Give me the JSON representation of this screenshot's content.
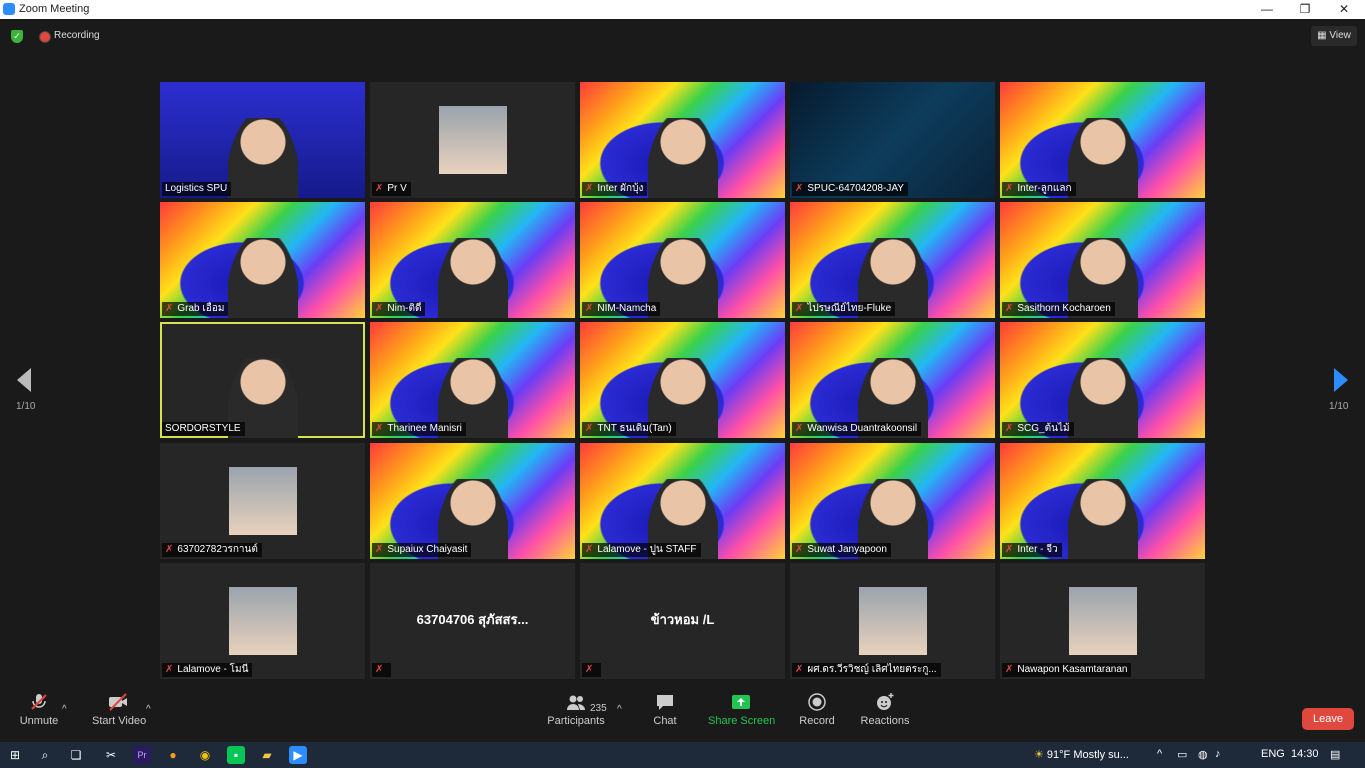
{
  "window": {
    "title": "Zoom Meeting",
    "minimize": "—",
    "maximize": "❐",
    "close": "✕"
  },
  "status": {
    "recording": "Recording",
    "view": "View"
  },
  "pager": {
    "left": "1/10",
    "right": "1/10"
  },
  "tiles": [
    {
      "name": "Logistics SPU",
      "muted": false,
      "bg": "blue"
    },
    {
      "name": "Pr V",
      "muted": true,
      "bg": "dark"
    },
    {
      "name": "Inter ผักบุ้ง",
      "muted": true,
      "bg": "camp"
    },
    {
      "name": "SPUC-64704208-JAY",
      "muted": true,
      "bg": "logistics"
    },
    {
      "name": "Inter-ลูกแลก",
      "muted": true,
      "bg": "camp"
    },
    {
      "name": "Grab เอื้อม",
      "muted": true,
      "bg": "camp"
    },
    {
      "name": "Nim-ติดี้",
      "muted": true,
      "bg": "camp"
    },
    {
      "name": "NIM-Namcha",
      "muted": true,
      "bg": "camp"
    },
    {
      "name": "ไปรษณีย์ไทย-Fluke",
      "muted": true,
      "bg": "camp"
    },
    {
      "name": "Sasithorn Kocharoen",
      "muted": true,
      "bg": "camp"
    },
    {
      "name": "SORDORSTYLE",
      "muted": false,
      "bg": "dark"
    },
    {
      "name": "Tharinee Manisri",
      "muted": true,
      "bg": "camp"
    },
    {
      "name": "TNT ธนเดิม(Tan)",
      "muted": true,
      "bg": "camp"
    },
    {
      "name": "Wanwisa Duantrakoonsil",
      "muted": true,
      "bg": "camp"
    },
    {
      "name": "SCG_ต้นไม้",
      "muted": true,
      "bg": "camp"
    },
    {
      "name": "63702782วรกานต์",
      "muted": true,
      "bg": "dark"
    },
    {
      "name": "Supaiux Chaiyasit",
      "muted": true,
      "bg": "camp"
    },
    {
      "name": "Lalamove - ปูน STAFF",
      "muted": true,
      "bg": "camp"
    },
    {
      "name": "Suwat Janyapoon",
      "muted": true,
      "bg": "camp"
    },
    {
      "name": "Inter - จีว",
      "muted": true,
      "bg": "camp"
    },
    {
      "name": "Lalamove - โมนี",
      "muted": true,
      "bg": "dark"
    },
    {
      "name": "",
      "muted": true,
      "bg": "dark",
      "big": "63704706 สุภัสสร..."
    },
    {
      "name": "",
      "muted": true,
      "bg": "dark",
      "big": "ข้าวหอม /L"
    },
    {
      "name": "ผศ.ดร.วีรวิชญ์ เลิศไทยตระกู...",
      "muted": true,
      "bg": "dark"
    },
    {
      "name": "Nawapon Kasamtaranan",
      "muted": true,
      "bg": "dark"
    }
  ],
  "toolbar": {
    "unmute": "Unmute",
    "start_video": "Start Video",
    "participants": "Participants",
    "participants_count": "235",
    "chat": "Chat",
    "share_screen": "Share Screen",
    "record": "Record",
    "reactions": "Reactions",
    "leave": "Leave"
  },
  "taskbar": {
    "weather": "91°F  Mostly su...",
    "lang": "ENG",
    "time": "14:30"
  },
  "colors": {
    "accent": "#2d8cff",
    "leave": "#e0483e",
    "share": "#23c552",
    "active_speaker": "#d6e34a"
  }
}
